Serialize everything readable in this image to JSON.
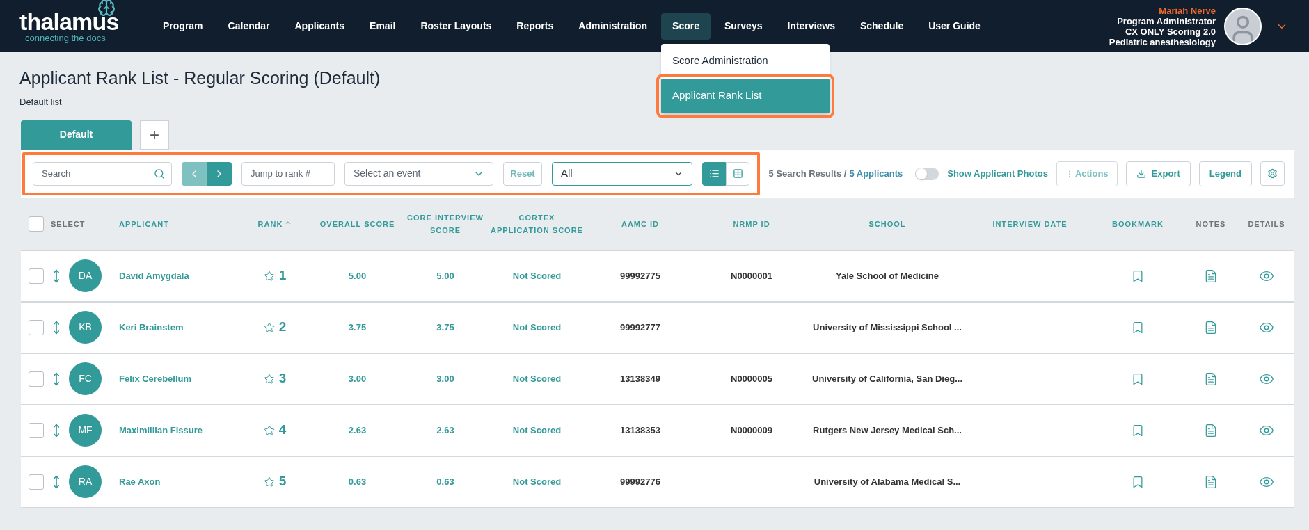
{
  "logo": {
    "name": "thalamus",
    "tagline": "connecting the docs"
  },
  "nav": [
    {
      "label": "Program",
      "selected": false
    },
    {
      "label": "Calendar",
      "selected": false
    },
    {
      "label": "Applicants",
      "selected": false
    },
    {
      "label": "Email",
      "selected": false
    },
    {
      "label": "Roster Layouts",
      "selected": false
    },
    {
      "label": "Reports",
      "selected": false
    },
    {
      "label": "Administration",
      "selected": false
    },
    {
      "label": "Score",
      "selected": true
    },
    {
      "label": "Surveys",
      "selected": false
    },
    {
      "label": "Interviews",
      "selected": false
    },
    {
      "label": "Schedule",
      "selected": false
    },
    {
      "label": "User Guide",
      "selected": false
    }
  ],
  "score_menu": [
    {
      "label": "Score Administration",
      "selected": false
    },
    {
      "label": "Applicant Rank List",
      "selected": true
    }
  ],
  "user": {
    "name": "Mariah Nerve",
    "role": "Program Administrator",
    "program": "CX ONLY Scoring 2.0",
    "specialty": "Pediatric anesthesiology"
  },
  "page": {
    "title": "Applicant Rank List - Regular Scoring (Default)",
    "subtitle": "Default list"
  },
  "tabs": [
    {
      "label": "Default",
      "selected": true
    }
  ],
  "add_tab": "+",
  "toolbar": {
    "search": {
      "placeholder": "Search"
    },
    "prev_disabled": true,
    "next_disabled": false,
    "jump": {
      "placeholder": "Jump to rank #"
    },
    "event": {
      "placeholder": "Select an event"
    },
    "reset": "Reset",
    "filter": {
      "value": "All"
    },
    "views": [
      {
        "kind": "list",
        "selected": true
      },
      {
        "kind": "grid",
        "selected": false
      }
    ],
    "results": "5 Search Results /",
    "applicants": "5 Applicants",
    "show_photos": {
      "label": "Show Applicant Photos",
      "on": false
    },
    "actions": "Actions",
    "export": "Export",
    "legend": "Legend"
  },
  "select_all_checked": false,
  "columns": [
    {
      "label": "SELECT",
      "sortable": false
    },
    {
      "label": "APPLICANT",
      "sortable": true
    },
    {
      "label": "RANK",
      "sortable": true,
      "sorted": true
    },
    {
      "label": "OVERALL SCORE",
      "sortable": true
    },
    {
      "label": "CORE INTERVIEW SCORE",
      "sortable": true
    },
    {
      "label": "CORTEX APPLICATION SCORE",
      "sortable": true
    },
    {
      "label": "AAMC ID",
      "sortable": true
    },
    {
      "label": "NRMP ID",
      "sortable": true
    },
    {
      "label": "SCHOOL",
      "sortable": true
    },
    {
      "label": "INTERVIEW DATE",
      "sortable": true
    },
    {
      "label": "BOOKMARK",
      "sortable": true
    },
    {
      "label": "NOTES",
      "sortable": false
    },
    {
      "label": "DETAILS",
      "sortable": false
    }
  ],
  "rows": [
    {
      "checked": false,
      "initials": "DA",
      "name": "David Amygdala",
      "rank": "1",
      "overall": "5.00",
      "core": "5.00",
      "cortex": "Not Scored",
      "aamc": "99992775",
      "nrmp": "N0000001",
      "school": "Yale School of Medicine"
    },
    {
      "checked": false,
      "initials": "KB",
      "name": "Keri Brainstem",
      "rank": "2",
      "overall": "3.75",
      "core": "3.75",
      "cortex": "Not Scored",
      "aamc": "99992777",
      "school": "University of Mississippi School ..."
    },
    {
      "checked": false,
      "initials": "FC",
      "name": "Felix Cerebellum",
      "rank": "3",
      "overall": "3.00",
      "core": "3.00",
      "cortex": "Not Scored",
      "aamc": "13138349",
      "nrmp": "N0000005",
      "school": "University of California, San Dieg..."
    },
    {
      "checked": false,
      "initials": "MF",
      "name": "Maximillian Fissure",
      "rank": "4",
      "overall": "2.63",
      "core": "2.63",
      "cortex": "Not Scored",
      "aamc": "13138353",
      "nrmp": "N0000009",
      "school": "Rutgers New Jersey Medical Sch..."
    },
    {
      "checked": false,
      "initials": "RA",
      "name": "Rae Axon",
      "rank": "5",
      "overall": "0.63",
      "core": "0.63",
      "cortex": "Not Scored",
      "aamc": "99992776",
      "school": "University of Alabama Medical S..."
    }
  ]
}
